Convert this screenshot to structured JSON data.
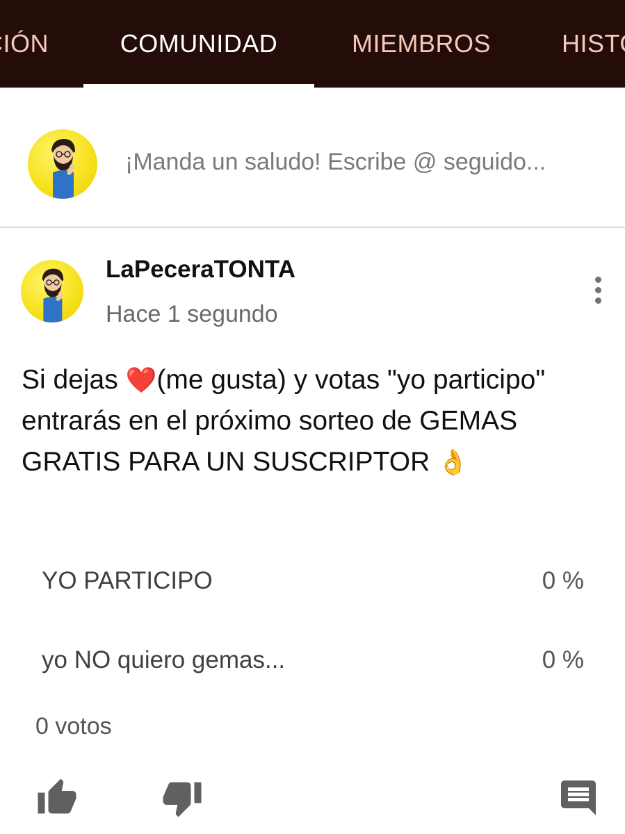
{
  "tabs": [
    {
      "label": "CIÓN",
      "active": false
    },
    {
      "label": "COMUNIDAD",
      "active": true
    },
    {
      "label": "MIEMBROS",
      "active": false
    },
    {
      "label": "HISTO",
      "active": false
    }
  ],
  "compose": {
    "placeholder": "¡Manda un saludo! Escribe @ seguido..."
  },
  "post": {
    "author": "LaPeceraTONTA",
    "time": "Hace 1 segundo",
    "text": {
      "part1": "Si dejas ",
      "heart": "❤️",
      "part2": "(me gusta) y votas \"yo participo\" entrarás en el próximo sorteo de GEMAS GRATIS PARA UN SUSCRIPTOR ",
      "ok_hand": "👌"
    }
  },
  "poll": {
    "options": [
      {
        "label": "YO PARTICIPO",
        "percent": "0 %"
      },
      {
        "label": "yo NO quiero gemas...",
        "percent": "0 %"
      }
    ],
    "votes": "0 votos"
  },
  "icons": {
    "avatar": "bearded-man-avatar-icon",
    "more": "more-vertical-icon",
    "like": "thumb-up-icon",
    "dislike": "thumb-down-icon",
    "comment": "comment-icon"
  },
  "colors": {
    "tabbar_bg": "#240c08",
    "tab_inactive": "#f5c9bb",
    "tab_active": "#ffffff",
    "avatar_bg": "#f7e21f",
    "heart": "#e0242b",
    "action_icon": "#606060"
  }
}
